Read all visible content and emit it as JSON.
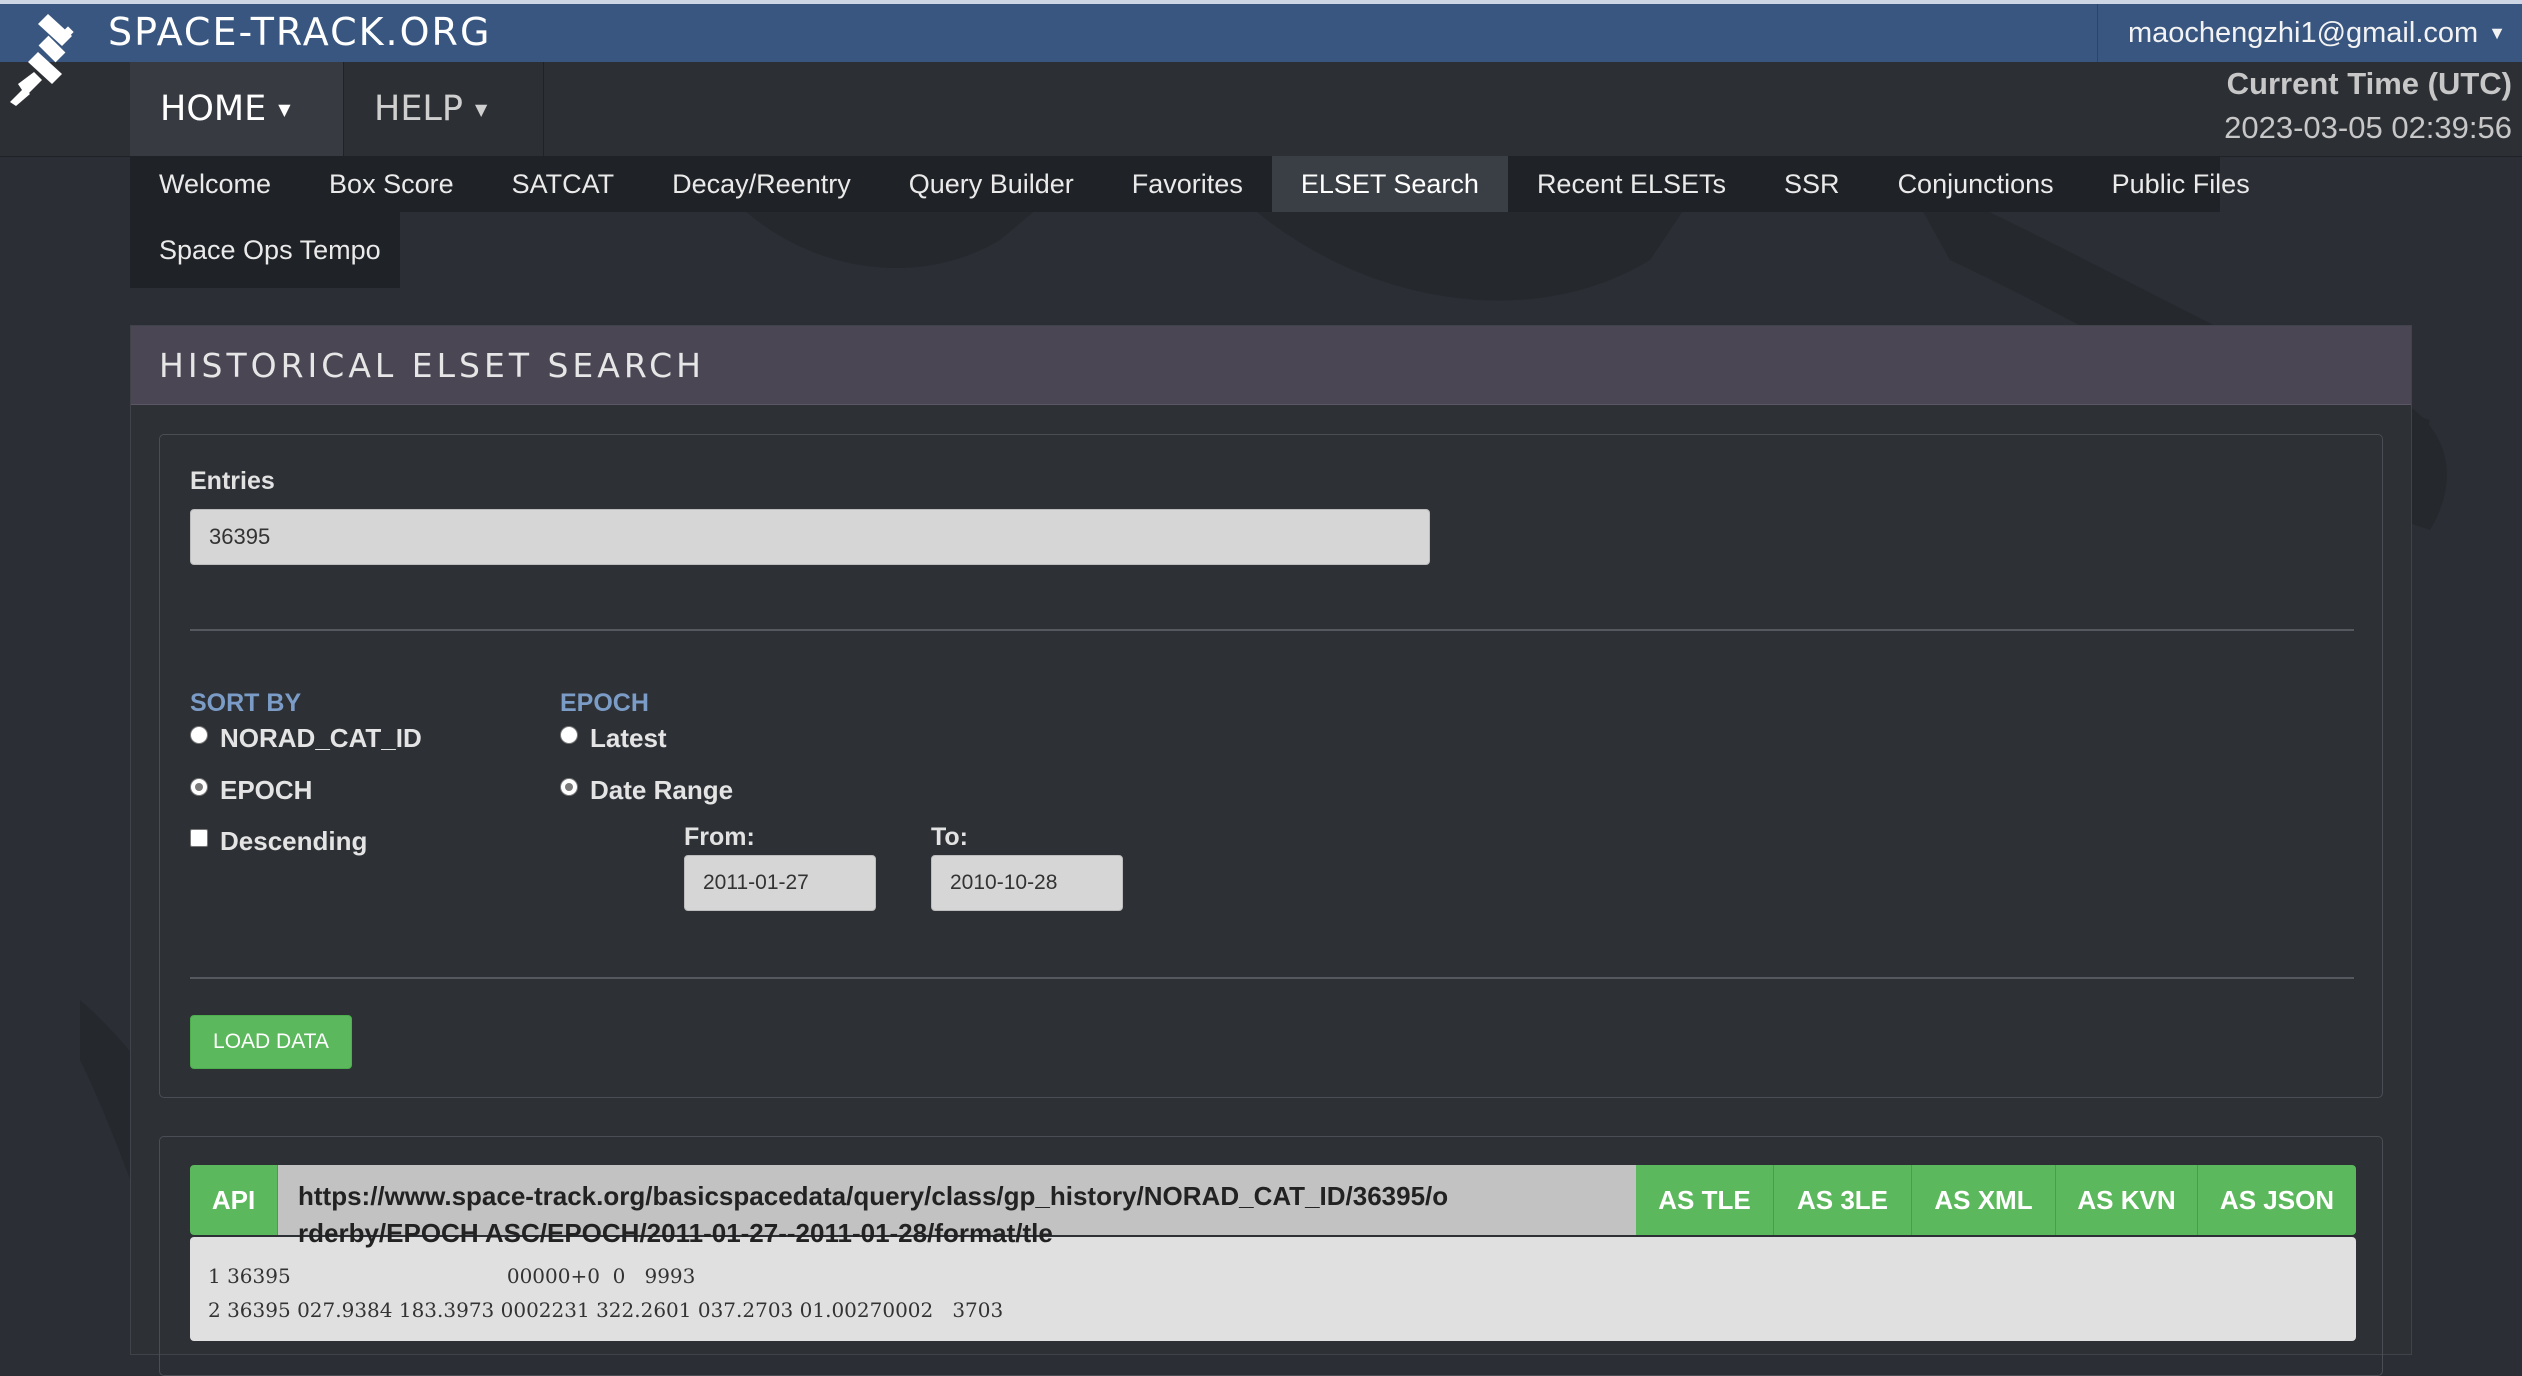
{
  "brand": {
    "name": "SPACE-TRACK.ORG"
  },
  "user": {
    "email": "maochengzhi1@gmail.com"
  },
  "nav": {
    "home": "HOME",
    "help": "HELP"
  },
  "clock": {
    "label": "Current Time (UTC)",
    "value": "2023-03-05 02:39:56"
  },
  "subnav": {
    "items": [
      "Welcome",
      "Box Score",
      "SATCAT",
      "Decay/Reentry",
      "Query Builder",
      "Favorites",
      "ELSET Search",
      "Recent ELSETs",
      "SSR",
      "Conjunctions",
      "Public Files"
    ],
    "second_row": "Space Ops Tempo",
    "active": "ELSET Search"
  },
  "panel": {
    "title": "HISTORICAL ELSET SEARCH",
    "entries_label": "Entries",
    "entries_value": "36395",
    "sort_by": {
      "title": "SORT BY",
      "norad": "NORAD_CAT_ID",
      "epoch": "EPOCH",
      "descending": "Descending",
      "selected": "EPOCH",
      "descending_checked": false
    },
    "epoch": {
      "title": "EPOCH",
      "latest": "Latest",
      "date_range": "Date Range",
      "selected": "Date Range",
      "from_label": "From:",
      "from_value": "2011-01-27",
      "to_label": "To:",
      "to_value": "2010-10-28"
    },
    "load_button": "LOAD DATA"
  },
  "results": {
    "api_label": "API",
    "api_url": "https://www.space-track.org/basicspacedata/query/class/gp_history/NORAD_CAT_ID/36395/orderby/EPOCH ASC/EPOCH/2011-01-27--2011-01-28/format/tle",
    "buttons": [
      "AS TLE",
      "AS 3LE",
      "AS XML",
      "AS KVN",
      "AS JSON"
    ],
    "line1": "1 36395                                  00000+0  0   9993",
    "line2": "2 36395 027.9384 183.3973 0002231 322.2601 037.2703 01.00270002   3703"
  },
  "colors": {
    "topbar": "#385680",
    "panel_heading": "#4a4654",
    "accent_blue": "#7b9cc6",
    "green": "#5cb85c"
  }
}
